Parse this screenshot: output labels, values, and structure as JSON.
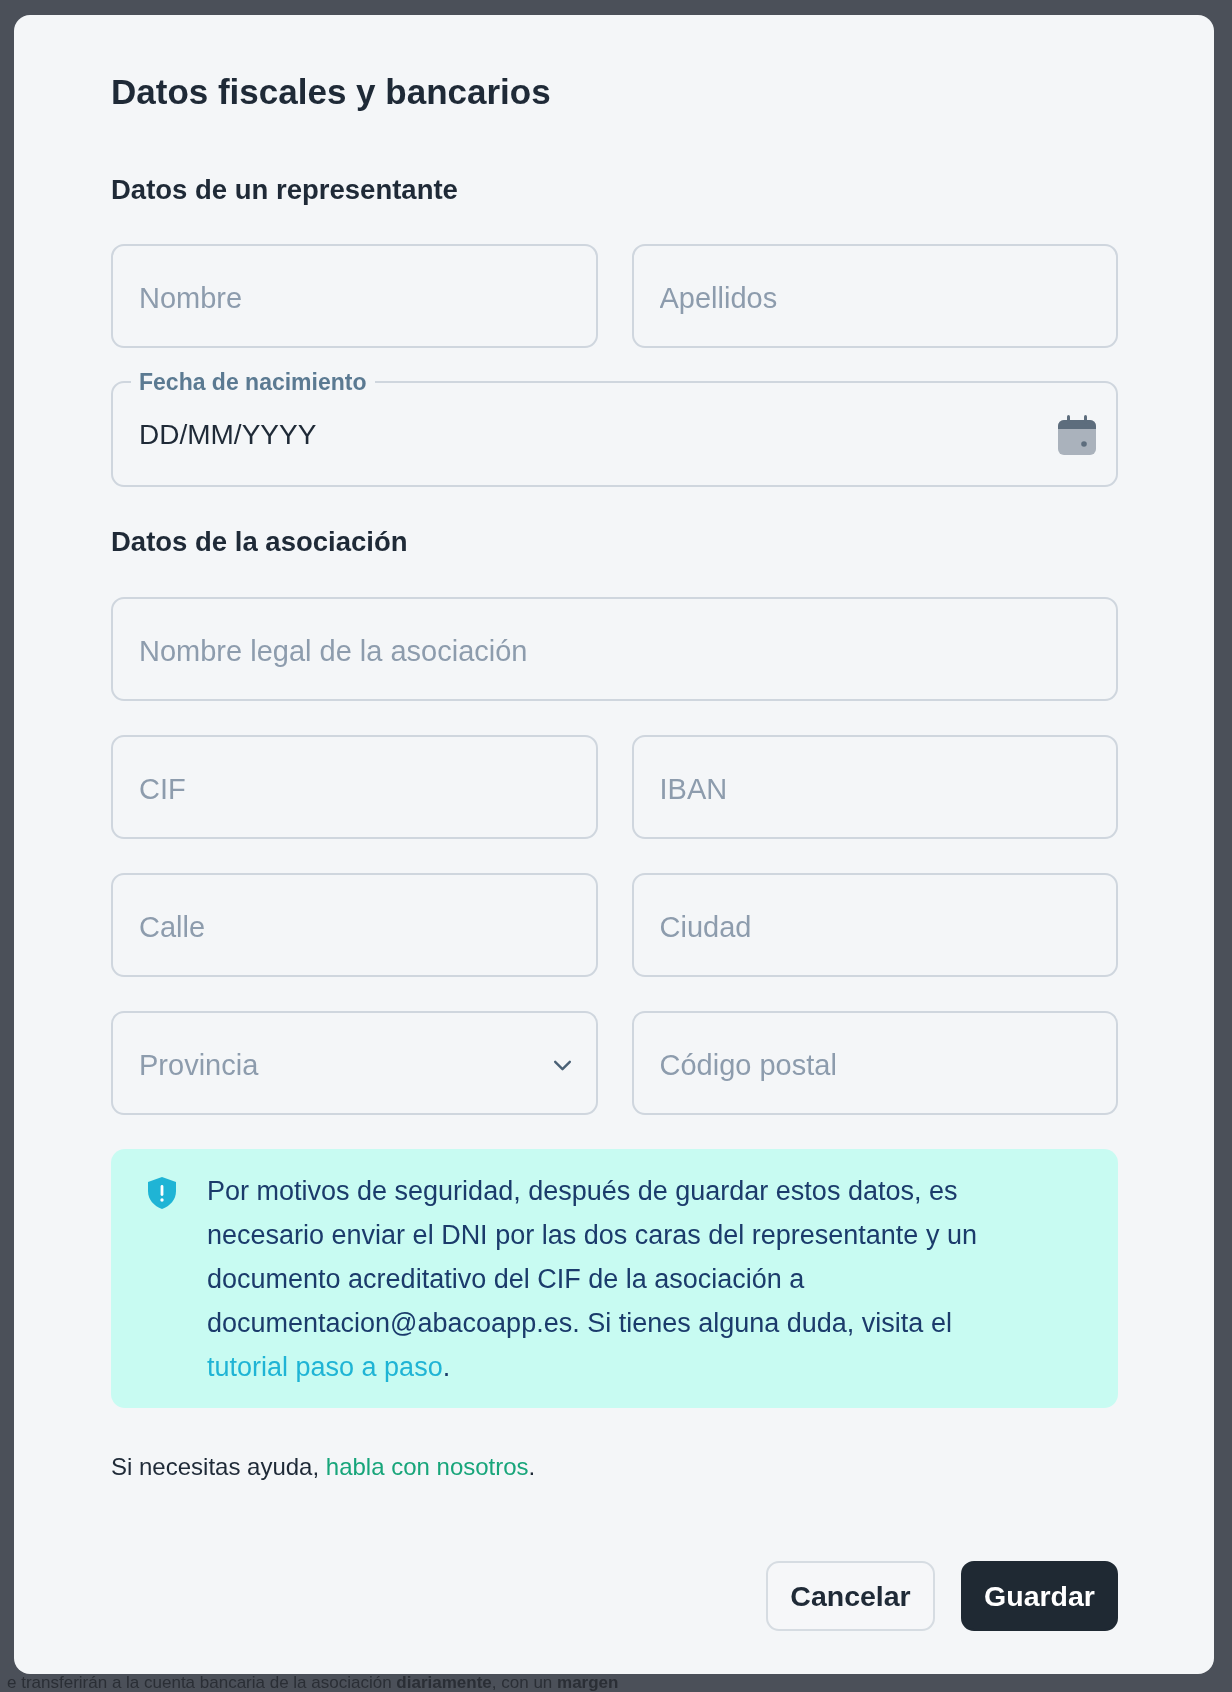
{
  "dialog": {
    "title": "Datos fiscales y bancarios"
  },
  "sections": [
    {
      "heading": "Datos de un representante",
      "rows": [
        [
          {
            "kind": "text",
            "placeholder": "Nombre"
          },
          {
            "kind": "text",
            "placeholder": "Apellidos"
          }
        ],
        [
          {
            "kind": "date",
            "label": "Fecha de nacimiento",
            "value": "DD/MM/YYYY"
          }
        ]
      ]
    },
    {
      "heading": "Datos de la asociación",
      "rows": [
        [
          {
            "kind": "text",
            "placeholder": "Nombre legal de la asociación"
          }
        ],
        [
          {
            "kind": "text",
            "placeholder": "CIF"
          },
          {
            "kind": "text",
            "placeholder": "IBAN"
          }
        ],
        [
          {
            "kind": "text",
            "placeholder": "Calle"
          },
          {
            "kind": "text",
            "placeholder": "Ciudad"
          }
        ],
        [
          {
            "kind": "select",
            "placeholder": "Provincia"
          },
          {
            "kind": "text",
            "placeholder": "Código postal"
          }
        ]
      ]
    }
  ],
  "notice": {
    "text": "Por motivos de seguridad, después de guardar estos datos, es necesario enviar el DNI por las dos caras del representante y un documento acreditativo del CIF de la asociación a documentacion@abacoapp.es. Si tienes alguna duda, visita el",
    "link": "tutorial paso a paso",
    "end": "."
  },
  "help": {
    "text": "Si necesitas ayuda,",
    "link": "habla con nosotros",
    "end": "."
  },
  "buttons": [
    {
      "label": "Cancelar",
      "kind": "secondary"
    },
    {
      "label": "Guardar",
      "kind": "primary"
    }
  ],
  "background_page": {
    "text": "e transferirán a la cuenta bancaria de la asociación **diariamente**, con un **margen**"
  }
}
